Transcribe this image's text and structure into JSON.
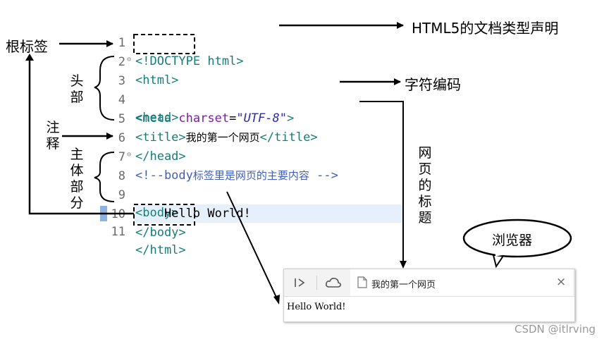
{
  "code": {
    "lines": [
      {
        "num": "1",
        "text": "<!DOCTYPE html>"
      },
      {
        "num": "2",
        "text": "<html>"
      },
      {
        "num": "3",
        "text": "<head>"
      },
      {
        "num": "4",
        "tag_open": "<meta ",
        "attr": "charset",
        "eq": "=",
        "val": "\"UTF-8\"",
        "tag_close": ">"
      },
      {
        "num": "5",
        "tag_open": "<title>",
        "content": "我的第一个网页",
        "tag_close": "</title>"
      },
      {
        "num": "6",
        "text": "</head>"
      },
      {
        "num": "7",
        "comment_start": "<!--body",
        "comment_cjk": "标签里是网页的主要内容",
        "comment_end": " -->"
      },
      {
        "num": "8",
        "text": "<body>"
      },
      {
        "num": "9",
        "text": "    Hello World!"
      },
      {
        "num": "10",
        "text": "</body>"
      },
      {
        "num": "11",
        "text": "</html>"
      }
    ]
  },
  "annotations": {
    "doctype": "HTML5的文档类型声明",
    "root_tag": "根标签",
    "head_part": [
      "头",
      "部"
    ],
    "encoding": "字符编码",
    "comment": [
      "注",
      "释"
    ],
    "body_part": [
      "主",
      "体",
      "部",
      "分"
    ],
    "page_title": [
      "网",
      "页",
      "的",
      "标",
      "题"
    ],
    "browser": "浏览器"
  },
  "browser": {
    "tab_title": "我的第一个网页",
    "close": "×",
    "content": "Hello World!"
  },
  "watermark": "CSDN @itlrving"
}
